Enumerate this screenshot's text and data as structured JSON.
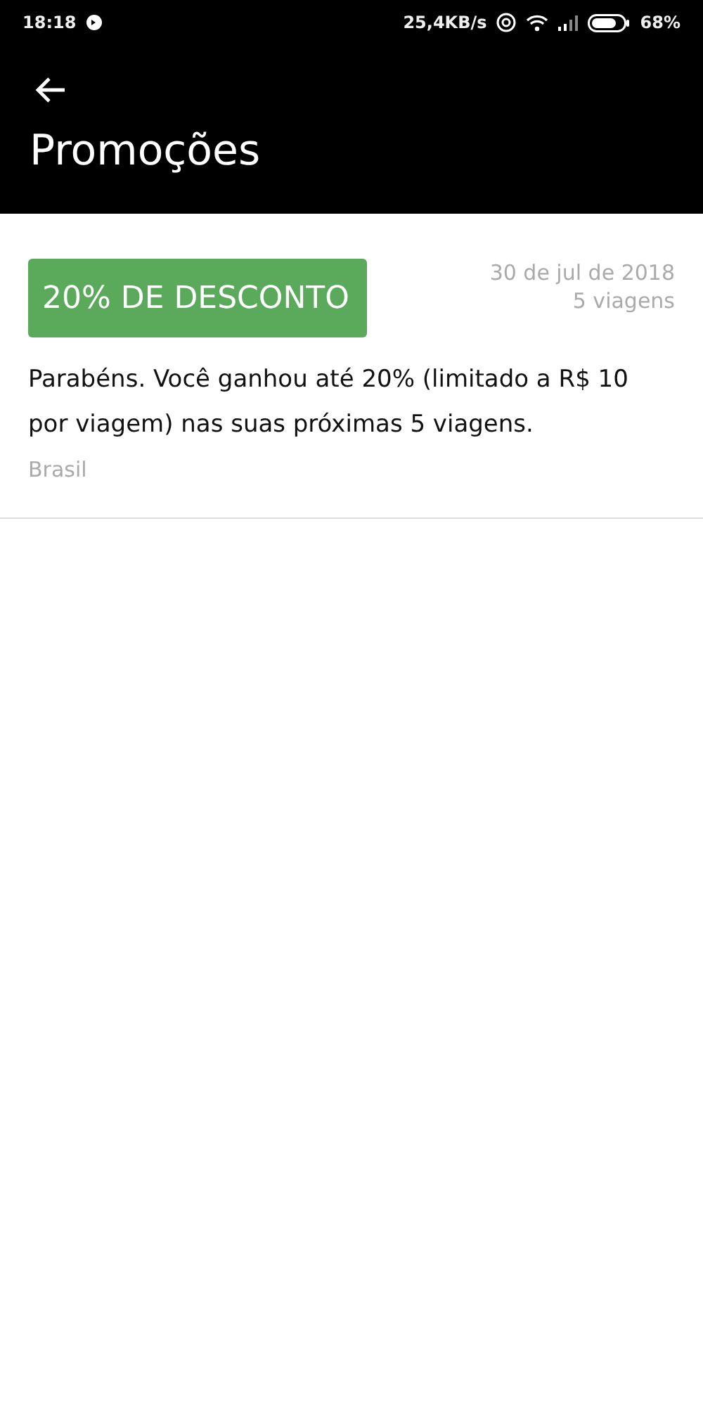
{
  "status_bar": {
    "time": "18:18",
    "speed": "25,4KB/s",
    "battery": "68%"
  },
  "header": {
    "title": "Promoções"
  },
  "promotions": [
    {
      "badge": "20% DE DESCONTO",
      "date": "30 de jul de 2018",
      "trips": "5 viagens",
      "description": "Parabéns. Você ganhou até 20% (limitado a R$ 10 por viagem) nas suas próximas 5 viagens.",
      "region": "Brasil"
    }
  ]
}
